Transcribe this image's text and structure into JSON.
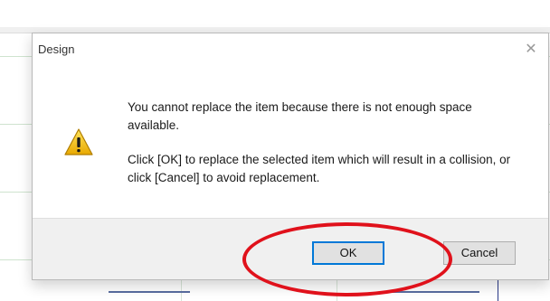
{
  "dialog": {
    "title": "Design",
    "close_icon": "close-icon",
    "icon": "warning-icon",
    "message_line1": "You cannot replace the item because there is not enough space available.",
    "message_line2": "Click [OK] to replace the selected item which will result in a collision, or click [Cancel] to avoid replacement.",
    "ok_label": "OK",
    "cancel_label": "Cancel"
  },
  "colors": {
    "highlight": "#e0111b",
    "ok_focus": "#0078d7",
    "warning": "#f2c200"
  }
}
